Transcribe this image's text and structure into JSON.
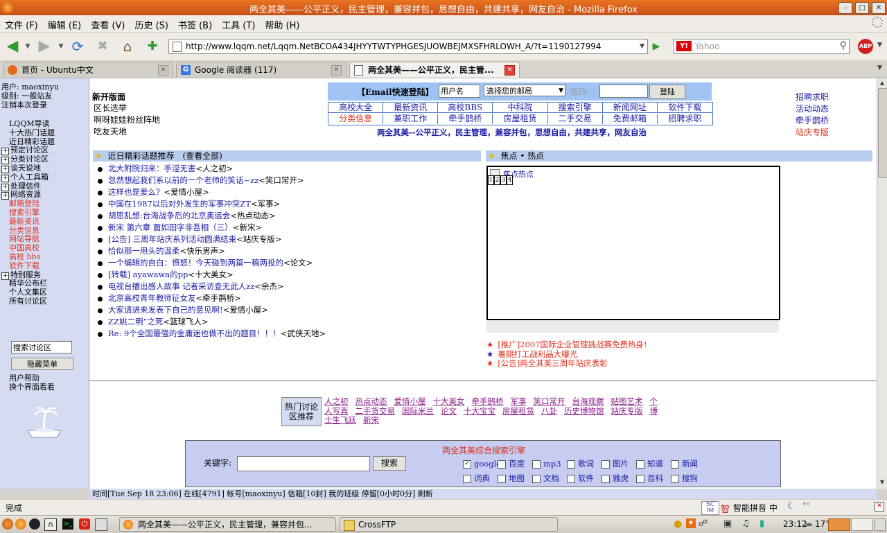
{
  "window": {
    "title": "两全其美——公平正义，民主管理，兼容并包，思想自由，共建共享，网友自治 - Mozilla Firefox"
  },
  "menu": [
    "文件 (F)",
    "编辑 (E)",
    "查看 (V)",
    "历史 (S)",
    "书签 (B)",
    "工具 (T)",
    "帮助 (H)"
  ],
  "url": "http://www.lqqm.net/Lqqm.NetBCOA434JHYYTWTYPHGESJUOWBEJMXSFHRLOWH_A/?t=1190127994",
  "search": {
    "placeholder": "Yahoo"
  },
  "tabs": [
    {
      "label": "首页 - Ubuntu中文"
    },
    {
      "label": "Google 阅读器 (117)"
    },
    {
      "label": "两全其美——公平正义，民主管..."
    }
  ],
  "left": {
    "user": "用户: maoxinyu",
    "level": "级别: 一般站友",
    "logout": "注销本次登录",
    "nav": [
      {
        "label": "LQQM导读",
        "plus": false,
        "red": false
      },
      {
        "label": "十大热门话题",
        "plus": false,
        "red": false
      },
      {
        "label": "近日精彩话题",
        "plus": false,
        "red": false
      },
      {
        "label": "预定讨论区",
        "plus": true,
        "red": false
      },
      {
        "label": "分类讨论区",
        "plus": true,
        "red": false
      },
      {
        "label": "谈天说地",
        "plus": true,
        "red": false
      },
      {
        "label": "个人工具箱",
        "plus": true,
        "red": false
      },
      {
        "label": "处理信件",
        "plus": true,
        "red": false
      },
      {
        "label": "网络资源",
        "plus": true,
        "red": false
      },
      {
        "label": "邮箱登陆",
        "plus": false,
        "red": true
      },
      {
        "label": "搜索引擎",
        "plus": false,
        "red": true
      },
      {
        "label": "最新资讯",
        "plus": false,
        "red": true
      },
      {
        "label": "分类信息",
        "plus": false,
        "red": true
      },
      {
        "label": "网站导航",
        "plus": false,
        "red": true
      },
      {
        "label": "中国高校",
        "plus": false,
        "red": true
      },
      {
        "label": "高校 bbs",
        "plus": false,
        "red": true
      },
      {
        "label": "软件下载",
        "plus": false,
        "red": true
      },
      {
        "label": "特别服务",
        "plus": true,
        "red": false
      },
      {
        "label": "精华公布栏",
        "plus": false,
        "red": false
      },
      {
        "label": "个人文集区",
        "plus": false,
        "red": false
      },
      {
        "label": "所有讨论区",
        "plus": false,
        "red": false
      }
    ],
    "search_board_value": "搜索讨论区",
    "hide_menu": "隐藏菜单",
    "help": "用户帮助",
    "change_ui": "换个界面看看"
  },
  "header": {
    "new_boards_title": "新开版面",
    "new_boards": [
      "区长选举",
      "啊呀娃娃粉丝阵地",
      "吃友天地"
    ],
    "email_login_label": "【Email快速登陆】",
    "username_value": "用户名",
    "mailbox_select": "选择您的邮局",
    "password_label": "密码:",
    "login_button": "登陆",
    "links_row1": [
      "高校大全",
      "最新资讯",
      "高校BBS",
      "中科院",
      "搜索引擎",
      "新闻网址",
      "软件下载"
    ],
    "links_row2": [
      "分类信息",
      "兼职工作",
      "牵手鹊桥",
      "房屋租赁",
      "二手交易",
      "免费邮箱",
      "招聘求职"
    ],
    "slogan": "两全其美--公平正义，民主管理，兼容并包，思想自由，共建共享，网友自治",
    "right_links": [
      "招聘求职",
      "活动动态",
      "牵手鹊桥",
      "站庆专版"
    ]
  },
  "topics": {
    "section_title": "近日精彩话题推荐",
    "view_all": "(查看全部)",
    "items": [
      {
        "title": "北大附院归来：手淫无害",
        "board": "<人之初>"
      },
      {
        "title": "忽然想起我们系以前的一个老师的笑话~zz",
        "board": "<笑口常开>"
      },
      {
        "title": "这样也是爱么？",
        "board": "<爱情小屋>"
      },
      {
        "title": "中国在1987以后对外发生的军事冲突ZT",
        "board": "<军事>"
      },
      {
        "title": "胡思乱想:台海战争后的北京奥运会",
        "board": "<热点动态>"
      },
      {
        "title": "新宋 第六章 面如田字非吾相（三）",
        "board": "<新宋>"
      },
      {
        "title": "[公告] 三周年站庆系列活动圆满结束",
        "board": "<站庆专版>"
      },
      {
        "title": "恰似那一甩头的温柔",
        "board": "<快乐男声>"
      },
      {
        "title": "一个编辑的自白：愤怒！今天碰到两篇一稿两投的",
        "board": "<论文>"
      },
      {
        "title": "[转载] ayawawa的pp",
        "board": "<十大美女>"
      },
      {
        "title": "电视台播出感人故事 记者采访查无此人zz",
        "board": "<余杰>"
      },
      {
        "title": "北京高校青年教师征女友",
        "board": "<牵手鹊桥>"
      },
      {
        "title": "大家请进来发表下自己的意见啊!",
        "board": "<爱情小屋>"
      },
      {
        "title": "ZZ姚二明”之死",
        "board": "<篮球飞人>"
      },
      {
        "title": "Re: 9个全国最强的金庸迷也做不出的题目！！！",
        "board": "<武侠天地>"
      }
    ]
  },
  "focus": {
    "section_title": "焦点 • 热点",
    "image_caption": "焦点热点",
    "pages": [
      "1",
      "2",
      "3",
      "4"
    ],
    "announcements": [
      {
        "text": "[推广]2007国际企业管理挑战赛免费热身!",
        "star": "red"
      },
      {
        "text": "暑期打工战利品大曝光",
        "star": "blue"
      },
      {
        "text": "[公告]两全其美三周年站庆表彰",
        "star": "red"
      }
    ]
  },
  "hot_boards": {
    "label_line1": "热门讨论",
    "label_line2": "区推荐",
    "row1": [
      "人之初",
      "热点动态",
      "爱情小屋",
      "十大美女",
      "牵手鹊桥",
      "军事",
      "笑口常开",
      "台海观察",
      "贴图艺术",
      "个"
    ],
    "row2": [
      "人写真",
      "二手货交易",
      "国际米兰",
      "论文",
      "十大宝宝",
      "房屋租赁",
      "八卦",
      "历史博物馆",
      "站庆专版",
      "博"
    ],
    "row3": [
      "士生飞跃",
      "新宋"
    ]
  },
  "search_engine": {
    "title": "两全其美综合搜索引擎",
    "keyword_label": "关键字:",
    "search_button": "搜索",
    "row1": [
      {
        "label": "google",
        "checked": true
      },
      {
        "label": "百度",
        "checked": false
      },
      {
        "label": "mp3",
        "checked": false
      },
      {
        "label": "歌词",
        "checked": false
      },
      {
        "label": "图片",
        "checked": false
      },
      {
        "label": "知道",
        "checked": false
      },
      {
        "label": "新闻",
        "checked": false
      }
    ],
    "row2": [
      {
        "label": "词典",
        "checked": false
      },
      {
        "label": "地图",
        "checked": false
      },
      {
        "label": "文档",
        "checked": false
      },
      {
        "label": "软件",
        "checked": false
      },
      {
        "label": "雅虎",
        "checked": false
      },
      {
        "label": "百科",
        "checked": false
      },
      {
        "label": "搜狗",
        "checked": false
      }
    ]
  },
  "bottom_status": "时间[Tue Sep 18 23:06] 在线[4791] 帐号[maoxinyu] 信箱[10封] 我的班级 停留[0小时0分] 刷新",
  "statusbar": {
    "text": "完成"
  },
  "ime": {
    "label": "智能拼音 中"
  },
  "taskbar": {
    "windows": [
      "两全其美——公平正义，民主管理，兼容并包...",
      "CrossFTP"
    ],
    "time": "23:12",
    "temp": "17°C"
  }
}
